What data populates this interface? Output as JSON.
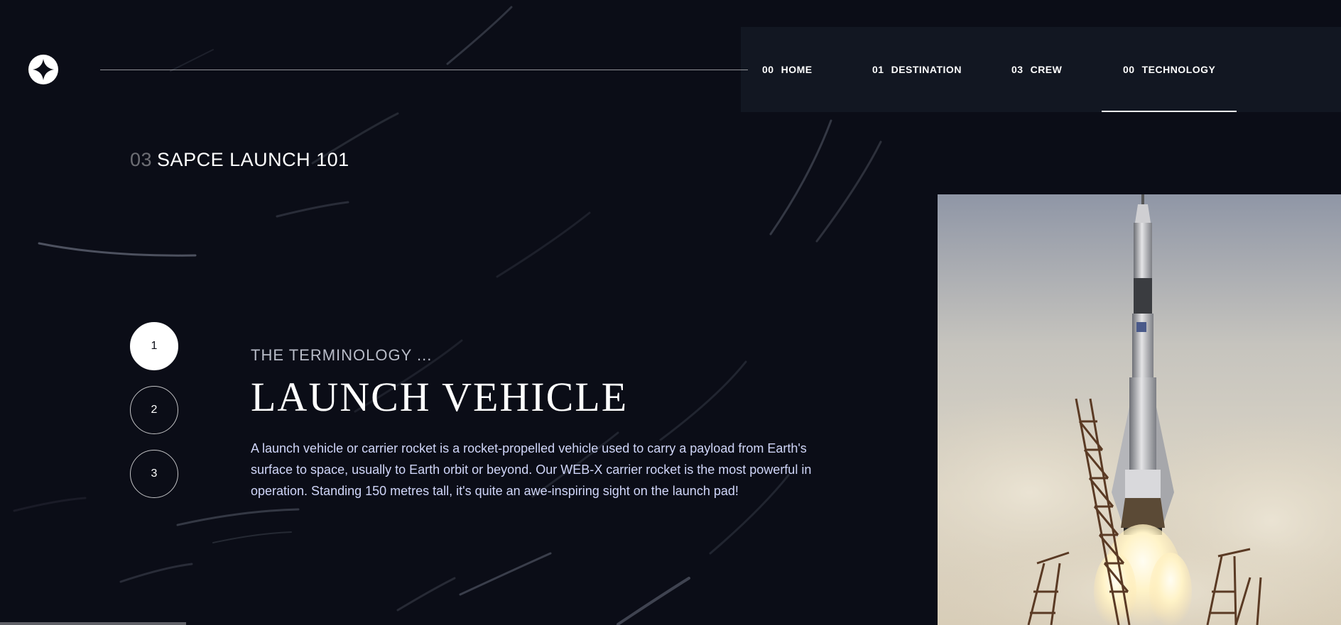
{
  "nav": {
    "items": [
      {
        "num": "00",
        "label": "HOME"
      },
      {
        "num": "01",
        "label": "DESTINATION"
      },
      {
        "num": "03",
        "label": "CREW"
      },
      {
        "num": "00",
        "label": "TECHNOLOGY",
        "active": true
      }
    ]
  },
  "page": {
    "heading_num": "03",
    "heading_text": "SAPCE LAUNCH 101"
  },
  "steps": [
    "1",
    "2",
    "3"
  ],
  "active_step": 1,
  "content": {
    "subtitle": "THE TERMINOLOGY ...",
    "title": "LAUNCH VEHICLE",
    "body": "A launch vehicle or carrier rocket is a rocket-propelled vehicle used to carry a payload from Earth's surface to space, usually to Earth orbit or beyond. Our WEB-X carrier rocket is the most powerful in operation. Standing 150 metres tall, it's quite an awe-inspiring sight on the launch pad!"
  },
  "colors": {
    "background": "#0b0d17",
    "text": "#ffffff",
    "body_text": "#d0d6f9",
    "nav_background": "#141824"
  },
  "icons": {
    "logo": "star-logo-icon"
  }
}
